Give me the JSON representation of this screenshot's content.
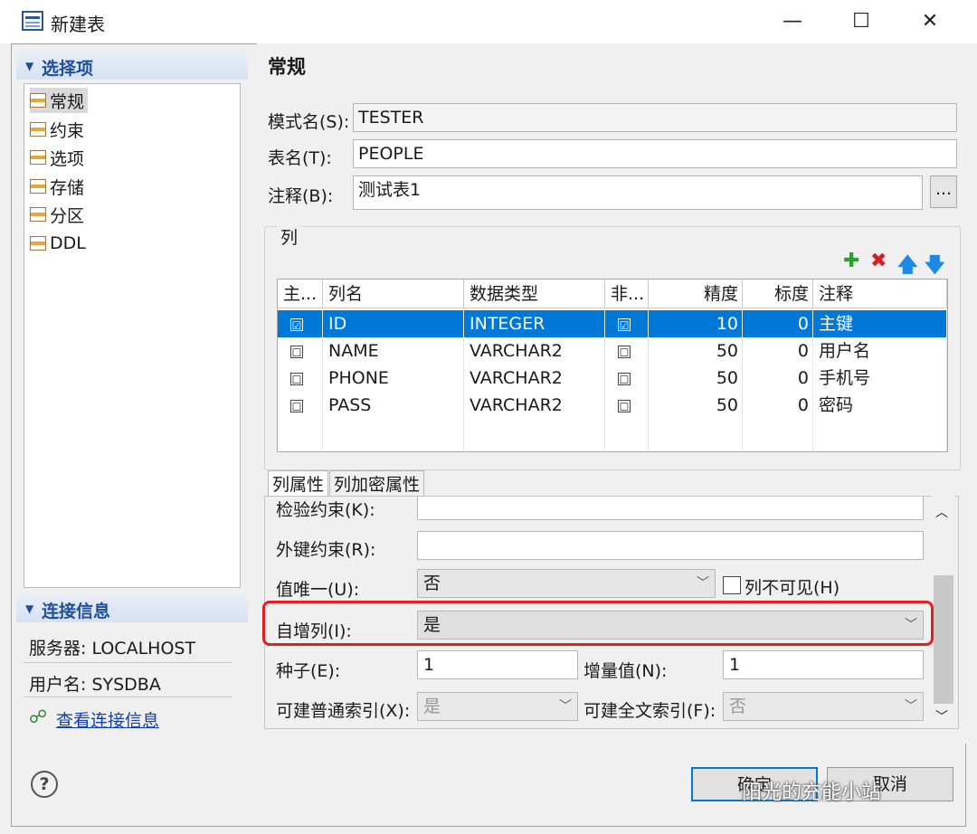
{
  "window": {
    "title": "新建表",
    "min_glyph": "—",
    "max_glyph": "☐",
    "close_glyph": "✕"
  },
  "left_panel": {
    "options_header": "选择项",
    "nav_items": [
      {
        "label": "常规",
        "selected": true
      },
      {
        "label": "约束",
        "selected": false
      },
      {
        "label": "选项",
        "selected": false
      },
      {
        "label": "存储",
        "selected": false
      },
      {
        "label": "分区",
        "selected": false
      },
      {
        "label": "DDL",
        "selected": false
      }
    ],
    "connection_header": "连接信息",
    "server": "服务器: LOCALHOST",
    "user": "用户名: SYSDBA",
    "view_link": "查看连接信息"
  },
  "general": {
    "section_title": "常规",
    "schema_label": "模式名(S):",
    "schema_value": "TESTER",
    "table_label": "表名(T):",
    "table_value": "PEOPLE",
    "comment_label": "注释(B):",
    "comment_value": "测试表1",
    "comment_more": "..."
  },
  "columns": {
    "group_label": "列",
    "tools": {
      "add": "✚",
      "remove": "✖",
      "up": "🡅",
      "down": "🡇"
    },
    "tool_colors": {
      "add": "#2ea02e",
      "remove": "#d42020",
      "up": "#1e88e5",
      "down": "#1e88e5"
    },
    "headers": [
      "主...",
      "列名",
      "数据类型",
      "非...",
      "精度",
      "标度",
      "注释"
    ],
    "rows": [
      {
        "pk": "☑",
        "name": "ID",
        "type": "INTEGER",
        "notnull": "☑",
        "precision": "10",
        "scale": "0",
        "comment": "主键",
        "selected": true
      },
      {
        "pk": "☐",
        "name": "NAME",
        "type": "VARCHAR2",
        "notnull": "☐",
        "precision": "50",
        "scale": "0",
        "comment": "用户名",
        "selected": false
      },
      {
        "pk": "☐",
        "name": "PHONE",
        "type": "VARCHAR2",
        "notnull": "☐",
        "precision": "50",
        "scale": "0",
        "comment": "手机号",
        "selected": false
      },
      {
        "pk": "☐",
        "name": "PASS",
        "type": "VARCHAR2",
        "notnull": "☐",
        "precision": "50",
        "scale": "0",
        "comment": "密码",
        "selected": false
      }
    ]
  },
  "props": {
    "tabs": [
      "列属性",
      "列加密属性"
    ],
    "check_label": "检验约束(K):",
    "fk_label": "外键约束(R):",
    "unique_label": "值唯一(U):",
    "unique_value": "否",
    "invisible_label": "列不可见(H)",
    "identity_label": "自增列(I):",
    "identity_value": "是",
    "seed_label": "种子(E):",
    "seed_value": "1",
    "increment_label": "增量值(N):",
    "increment_value": "1",
    "index_label": "可建普通索引(X):",
    "index_value": "是",
    "fulltext_label": "可建全文索引(F):",
    "fulltext_value": "否"
  },
  "footer": {
    "help": "?",
    "ok": "确定",
    "cancel": "取消"
  },
  "watermark": "阳光的充能小站"
}
